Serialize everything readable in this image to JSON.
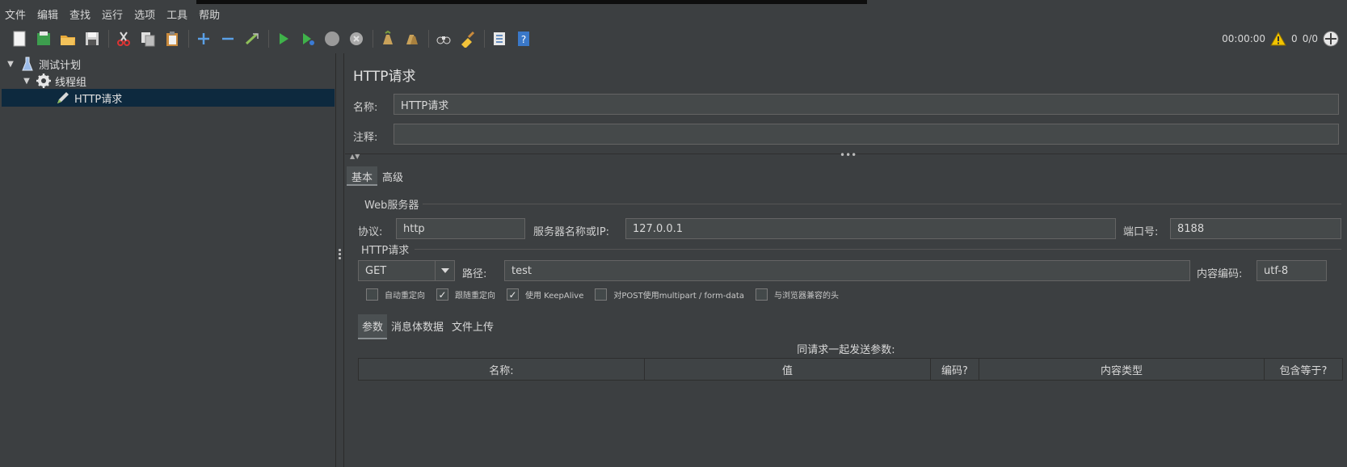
{
  "menu": [
    "文件",
    "编辑",
    "查找",
    "运行",
    "选项",
    "工具",
    "帮助"
  ],
  "toolbar_status": {
    "timer": "00:00:00",
    "warnings": "0",
    "threads": "0/0"
  },
  "tree": {
    "root": "测试计划",
    "thread_group": "线程组",
    "sampler": "HTTP请求"
  },
  "panel": {
    "title": "HTTP请求",
    "name_label": "名称:",
    "name_value": "HTTP请求",
    "comment_label": "注释:",
    "comment_value": ""
  },
  "tabs": {
    "basic": "基本",
    "advanced": "高级"
  },
  "web_server": {
    "group_title": "Web服务器",
    "protocol_label": "协议:",
    "protocol_value": "http",
    "server_label": "服务器名称或IP:",
    "server_value": "127.0.0.1",
    "port_label": "端口号:",
    "port_value": "8188"
  },
  "http_request": {
    "group_title": "HTTP请求",
    "method": "GET",
    "path_label": "路径:",
    "path_value": "test",
    "encoding_label": "内容编码:",
    "encoding_value": "utf-8"
  },
  "options": [
    {
      "label": "自动重定向",
      "checked": false
    },
    {
      "label": "跟随重定向",
      "checked": true
    },
    {
      "label": "使用 KeepAlive",
      "checked": true
    },
    {
      "label": "对POST使用multipart / form-data",
      "checked": false
    },
    {
      "label": "与浏览器兼容的头",
      "checked": false
    }
  ],
  "sub_tabs": {
    "params": "参数",
    "body": "消息体数据",
    "files": "文件上传"
  },
  "params_table": {
    "caption": "同请求一起发送参数:",
    "columns": [
      "名称:",
      "值",
      "编码?",
      "内容类型",
      "包含等于?"
    ]
  }
}
